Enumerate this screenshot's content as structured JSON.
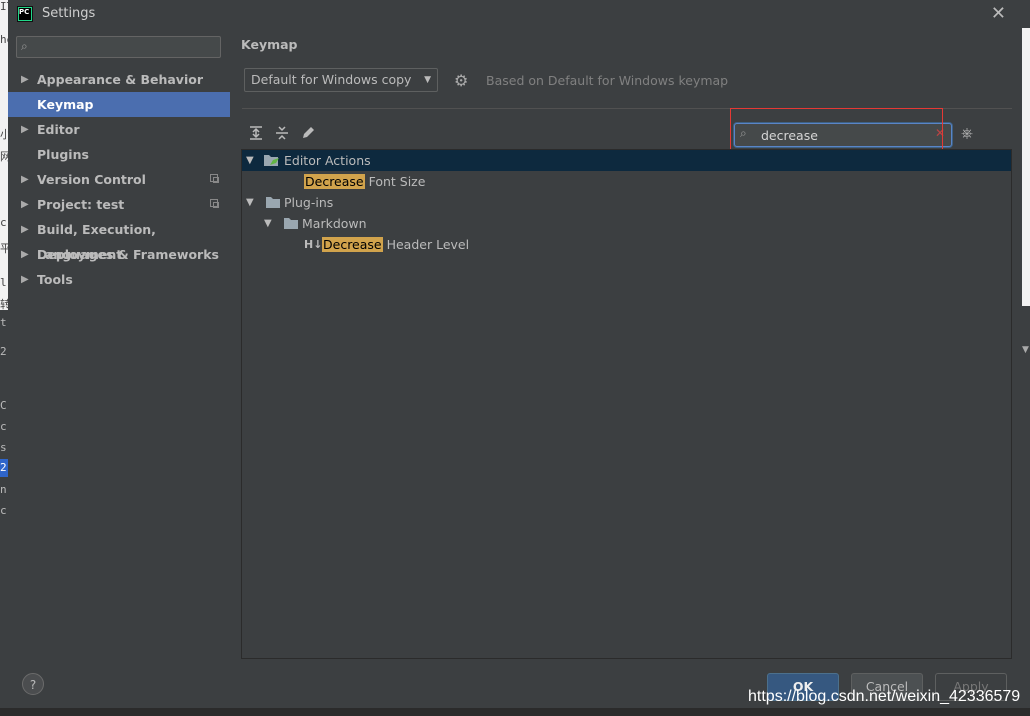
{
  "window": {
    "title": "Settings",
    "app_icon_text": "PC"
  },
  "sidebar": {
    "search_placeholder": "",
    "items": [
      {
        "label": "Appearance & Behavior",
        "expandable": true,
        "selected": false,
        "project_icon": false
      },
      {
        "label": "Keymap",
        "expandable": false,
        "selected": true,
        "project_icon": false
      },
      {
        "label": "Editor",
        "expandable": true,
        "selected": false,
        "project_icon": false
      },
      {
        "label": "Plugins",
        "expandable": false,
        "selected": false,
        "project_icon": false
      },
      {
        "label": "Version Control",
        "expandable": true,
        "selected": false,
        "project_icon": true
      },
      {
        "label": "Project: test",
        "expandable": true,
        "selected": false,
        "project_icon": true
      },
      {
        "label": "Build, Execution, Deployment",
        "expandable": true,
        "selected": false,
        "project_icon": false
      },
      {
        "label": "Languages & Frameworks",
        "expandable": true,
        "selected": false,
        "project_icon": false
      },
      {
        "label": "Tools",
        "expandable": true,
        "selected": false,
        "project_icon": false
      }
    ]
  },
  "keymap": {
    "title": "Keymap",
    "selected_keymap": "Default for Windows copy",
    "based_on": "Based on Default for Windows keymap",
    "search_value": "decrease"
  },
  "tree": {
    "rows": [
      {
        "level": 0,
        "expanded": true,
        "icon": "editor-actions-icon",
        "label": "Editor Actions",
        "selected": true
      },
      {
        "level": 1,
        "icon": "",
        "highlight": "Decrease",
        "rest": " Font Size"
      },
      {
        "level": 0,
        "expanded": true,
        "icon": "folder-icon",
        "label": "Plug-ins"
      },
      {
        "level": 1,
        "expanded": true,
        "icon": "folder-icon",
        "label": "Markdown"
      },
      {
        "level": 2,
        "icon": "header-level-icon",
        "icon_text": "H↓",
        "highlight": "Decrease",
        "rest": " Header Level"
      }
    ]
  },
  "footer": {
    "help_label": "?",
    "ok_label": "OK",
    "cancel_label": "Cancel",
    "apply_label": "Apply"
  },
  "watermark": "https://blog.csdn.net/weixin_42336579",
  "background_fragments": [
    "IT",
    "he",
    "小",
    "网",
    "c",
    "平",
    "l",
    "转",
    "t",
    "2",
    "C",
    "c",
    "s",
    "2.",
    "n",
    "c"
  ],
  "colors": {
    "selection": "#4b6eaf",
    "tree_selection": "#0d293e",
    "search_highlight": "#d1a34c",
    "ok_button": "#365880",
    "annotation_box": "#e53935"
  }
}
